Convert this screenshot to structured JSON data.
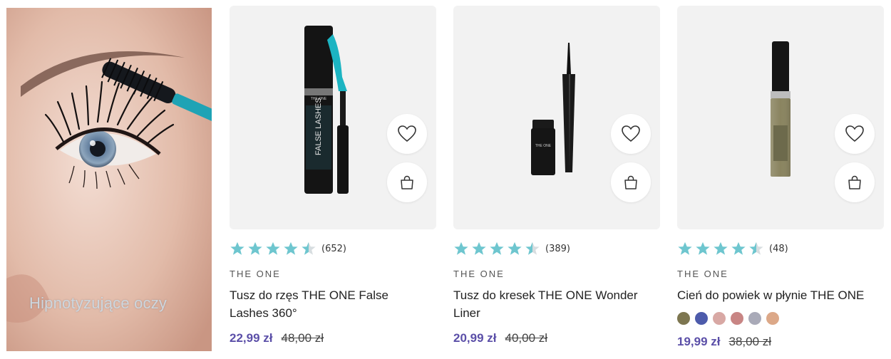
{
  "hero": {
    "caption": "Hipnotyzujące oczy"
  },
  "products": [
    {
      "rating_count": "(652)",
      "rating": 4.5,
      "brand": "THE ONE",
      "title": "Tusz do rzęs THE ONE False Lashes 360°",
      "price_now": "22,99 zł",
      "price_old": "48,00 zł",
      "package_label": "FALSE LASHES",
      "package_brand": "THE ONE"
    },
    {
      "rating_count": "(389)",
      "rating": 4.5,
      "brand": "THE ONE",
      "title": "Tusz do kresek THE ONE Wonder Liner",
      "price_now": "20,99 zł",
      "price_old": "40,00 zł",
      "package_brand": "THE ONE"
    },
    {
      "rating_count": "(48)",
      "rating": 4.5,
      "brand": "THE ONE",
      "title": "Cień do powiek w płynie THE ONE",
      "price_now": "19,99 zł",
      "price_old": "38,00 zł",
      "swatches": [
        "#7d7650",
        "#4d5bab",
        "#d8a8a4",
        "#c88584",
        "#a9aab8",
        "#dca888"
      ]
    }
  ],
  "icons": {
    "favorite": "heart-icon",
    "cart": "shopping-bag-icon",
    "star": "star-icon"
  },
  "colors": {
    "star": "#6ec6cf",
    "price_accent": "#5b4fa8",
    "card_bg": "#f2f2f2"
  }
}
